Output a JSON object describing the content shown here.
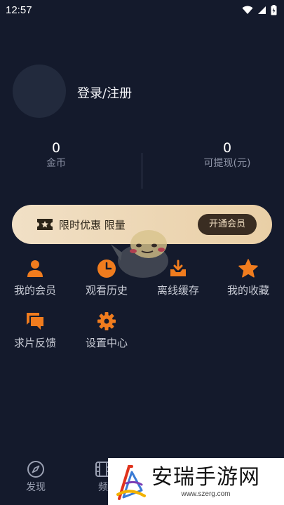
{
  "status_bar": {
    "time": "12:57"
  },
  "profile": {
    "login_label": "登录/注册"
  },
  "stats": [
    {
      "value": "0",
      "label": "金币"
    },
    {
      "value": "0",
      "label": "可提现(元)"
    }
  ],
  "vip": {
    "text": "限时优惠 限量",
    "button_label": "开通会员"
  },
  "menu": [
    {
      "label": "我的会员",
      "icon": "user-icon"
    },
    {
      "label": "观看历史",
      "icon": "clock-icon"
    },
    {
      "label": "离线缓存",
      "icon": "download-icon"
    },
    {
      "label": "我的收藏",
      "icon": "star-icon"
    },
    {
      "label": "求片反馈",
      "icon": "chat-icon"
    },
    {
      "label": "设置中心",
      "icon": "gear-icon"
    }
  ],
  "bottom_nav": [
    {
      "label": "发现",
      "icon": "compass-icon"
    },
    {
      "label": "频",
      "icon": "film-icon"
    }
  ],
  "watermark": {
    "title": "安瑞手游网",
    "url": "www.szerg.com"
  },
  "colors": {
    "accent": "#f07c1e",
    "background": "#141a2c",
    "vip_gradient_start": "#f1e0c6",
    "vip_gradient_end": "#e9cfa6"
  }
}
